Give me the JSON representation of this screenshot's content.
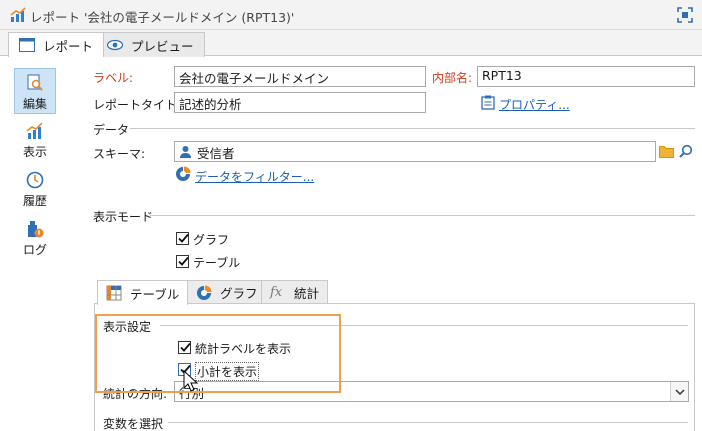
{
  "window": {
    "title": "レポート '会社の電子メールドメイン (RPT13)'"
  },
  "view_tabs": [
    {
      "label": "レポート",
      "active": true
    },
    {
      "label": "プレビュー",
      "active": false
    }
  ],
  "sidebar": {
    "items": [
      {
        "label": "編集",
        "icon": "edit-report-icon",
        "active": true
      },
      {
        "label": "表示",
        "icon": "chart-icon",
        "active": false
      },
      {
        "label": "履歴",
        "icon": "history-icon",
        "active": false
      },
      {
        "label": "ログ",
        "icon": "log-icon",
        "active": false
      }
    ]
  },
  "form": {
    "label_label": "ラベル:",
    "label_value": "会社の電子メールドメイン",
    "internal_name_label": "内部名:",
    "internal_name_value": "RPT13",
    "report_title_label": "レポートタイトル:",
    "report_title_value": "記述的分析",
    "properties_link": "プロパティ..."
  },
  "data_section": {
    "title": "データ",
    "schema_label": "スキーマ:",
    "schema_value": "受信者",
    "filter_link": "データをフィルター..."
  },
  "display_mode": {
    "title": "表示モード",
    "graph": {
      "label": "グラフ",
      "checked": true
    },
    "table": {
      "label": "テーブル",
      "checked": true
    }
  },
  "inner_tabs": [
    {
      "label": "テーブル",
      "active": true
    },
    {
      "label": "グラフ",
      "active": false
    },
    {
      "label": "統計",
      "active": false
    }
  ],
  "display_settings": {
    "title": "表示設定",
    "show_stat_labels": {
      "label": "統計ラベルを表示",
      "checked": true
    },
    "show_subtotals": {
      "label": "小計を表示",
      "checked": true
    },
    "stat_direction_label": "統計の方向:",
    "stat_direction_value": "行別",
    "variables_title": "変数を選択"
  },
  "colors": {
    "accent": "#1a5fb4",
    "highlight": "#f0a04a",
    "required": "#d03a1b",
    "active_side": "#cde4f7"
  }
}
